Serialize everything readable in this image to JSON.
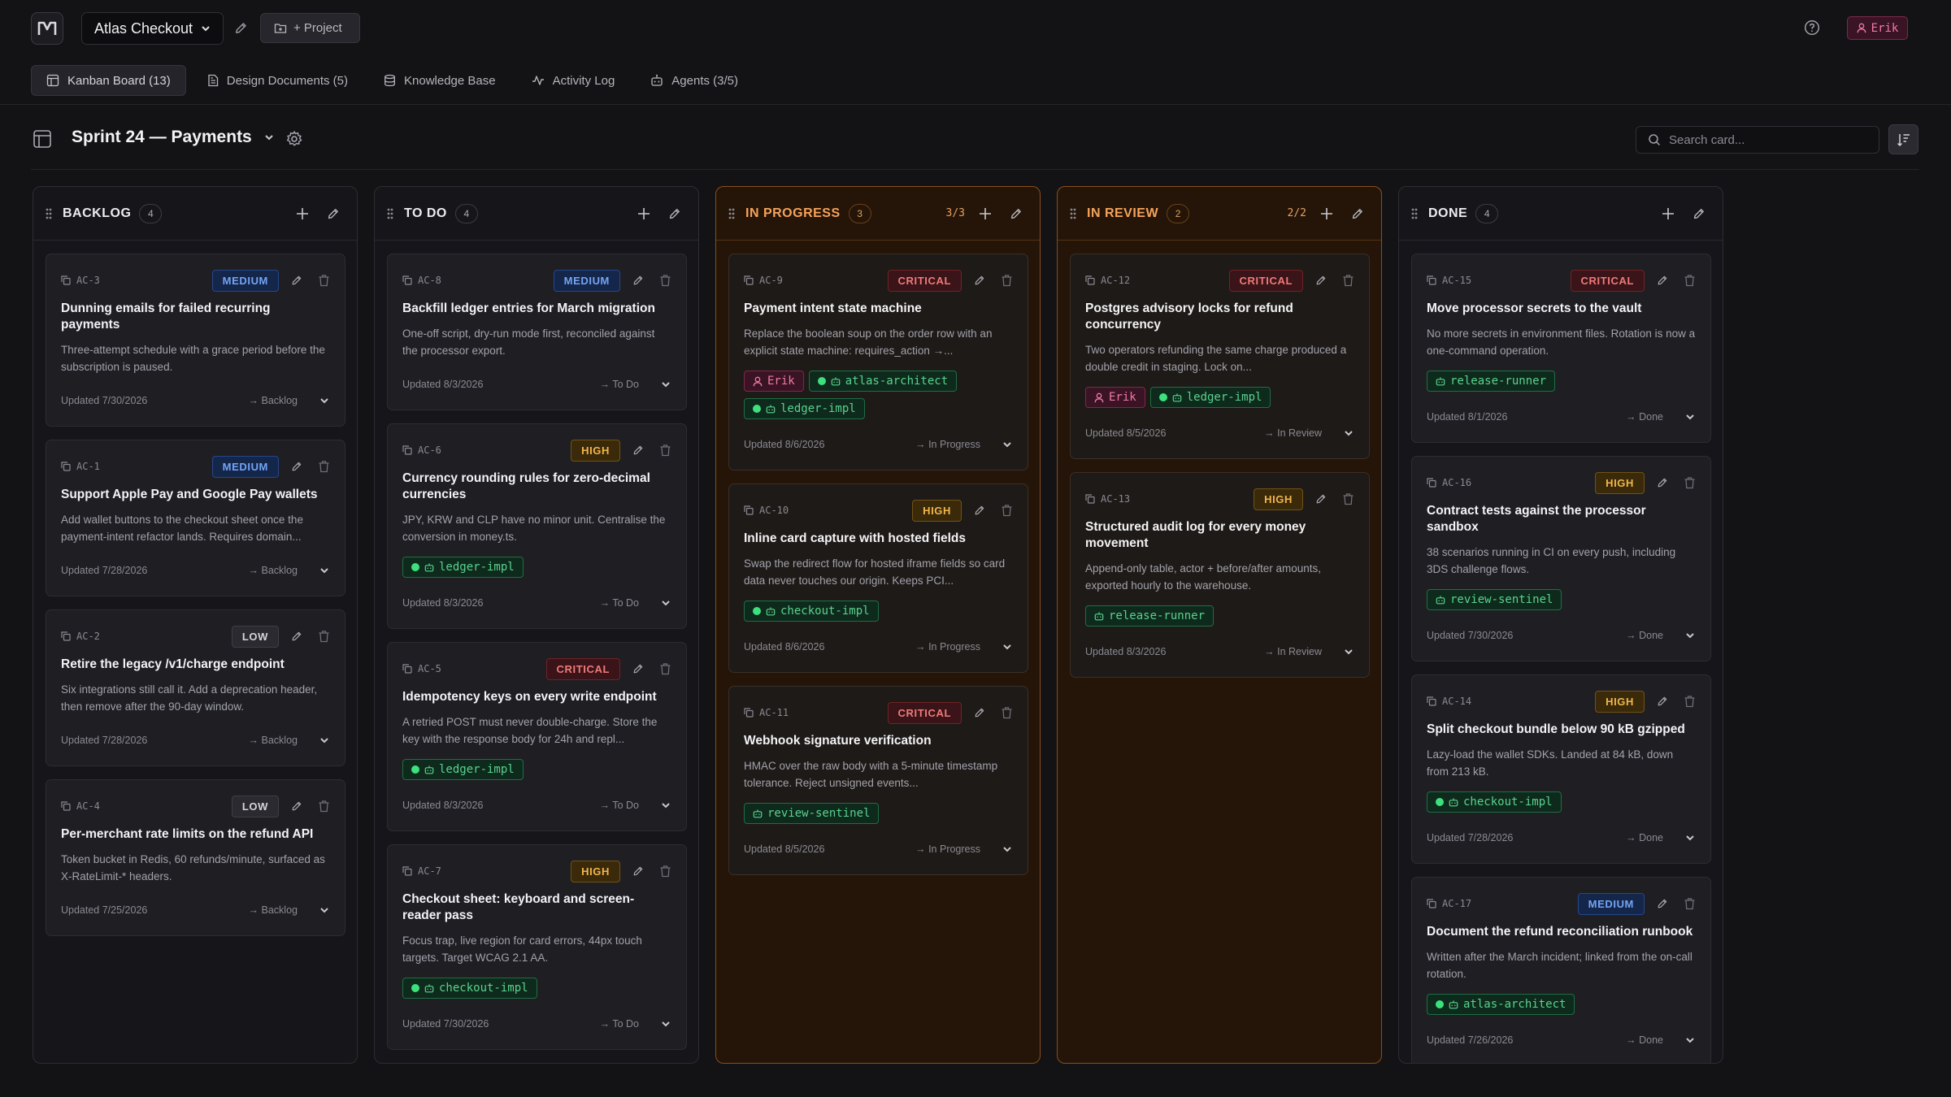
{
  "app": {
    "project_name": "Atlas Checkout",
    "add_project_label": "+ Project",
    "user": "Erik"
  },
  "tabs": [
    {
      "label": "Kanban Board (13)",
      "icon": "board-icon",
      "active": true
    },
    {
      "label": "Design Documents (5)",
      "icon": "document-icon",
      "active": false
    },
    {
      "label": "Knowledge Base",
      "icon": "database-icon",
      "active": false
    },
    {
      "label": "Activity Log",
      "icon": "activity-icon",
      "active": false
    },
    {
      "label": "Agents (3/5)",
      "icon": "robot-icon",
      "active": false
    }
  ],
  "board": {
    "title": "Sprint 24 — Payments",
    "search_placeholder": "Search card..."
  },
  "columns": [
    {
      "title": "BACKLOG",
      "count": "4",
      "wip": "",
      "highlight": false,
      "cards": [
        {
          "id": "AC-3",
          "priority": "MEDIUM",
          "title": "Dunning emails for failed recurring payments",
          "description": "Three-attempt schedule with a grace period before the subscription is paused.",
          "chips": [],
          "updated": "Updated 7/30/2026",
          "move": "→ Backlog"
        },
        {
          "id": "AC-1",
          "priority": "MEDIUM",
          "title": "Support Apple Pay and Google Pay wallets",
          "description": "Add wallet buttons to the checkout sheet once the payment-intent refactor lands. Requires domain...",
          "chips": [],
          "updated": "Updated 7/28/2026",
          "move": "→ Backlog"
        },
        {
          "id": "AC-2",
          "priority": "LOW",
          "title": "Retire the legacy /v1/charge endpoint",
          "description": "Six integrations still call it. Add a deprecation header, then remove after the 90-day window.",
          "chips": [],
          "updated": "Updated 7/28/2026",
          "move": "→ Backlog"
        },
        {
          "id": "AC-4",
          "priority": "LOW",
          "title": "Per-merchant rate limits on the refund API",
          "description": "Token bucket in Redis, 60 refunds/minute, surfaced as X-RateLimit-* headers.",
          "chips": [],
          "updated": "Updated 7/25/2026",
          "move": "→ Backlog"
        }
      ]
    },
    {
      "title": "TO DO",
      "count": "4",
      "wip": "",
      "highlight": false,
      "cards": [
        {
          "id": "AC-8",
          "priority": "MEDIUM",
          "title": "Backfill ledger entries for March migration",
          "description": "One-off script, dry-run mode first, reconciled against the processor export.",
          "chips": [],
          "updated": "Updated 8/3/2026",
          "move": "→ To Do"
        },
        {
          "id": "AC-6",
          "priority": "HIGH",
          "title": "Currency rounding rules for zero-decimal currencies",
          "description": "JPY, KRW and CLP have no minor unit. Centralise the conversion in money.ts.",
          "chips": [
            {
              "type": "agent",
              "label": "ledger-impl",
              "active": true
            }
          ],
          "updated": "Updated 8/3/2026",
          "move": "→ To Do"
        },
        {
          "id": "AC-5",
          "priority": "CRITICAL",
          "title": "Idempotency keys on every write endpoint",
          "description": "A retried POST must never double-charge. Store the key with the response body for 24h and repl...",
          "chips": [
            {
              "type": "agent",
              "label": "ledger-impl",
              "active": true
            }
          ],
          "updated": "Updated 8/3/2026",
          "move": "→ To Do"
        },
        {
          "id": "AC-7",
          "priority": "HIGH",
          "title": "Checkout sheet: keyboard and screen-reader pass",
          "description": "Focus trap, live region for card errors, 44px touch targets. Target WCAG 2.1 AA.",
          "chips": [
            {
              "type": "agent",
              "label": "checkout-impl",
              "active": true
            }
          ],
          "updated": "Updated 7/30/2026",
          "move": "→ To Do"
        }
      ]
    },
    {
      "title": "IN PROGRESS",
      "count": "3",
      "wip": "3/3",
      "highlight": true,
      "cards": [
        {
          "id": "AC-9",
          "priority": "CRITICAL",
          "title": "Payment intent state machine",
          "description": "Replace the boolean soup on the order row with an explicit state machine: requires_action →...",
          "chips": [
            {
              "type": "user",
              "label": "Erik"
            },
            {
              "type": "agent",
              "label": "atlas-architect",
              "active": true
            },
            {
              "type": "agent",
              "label": "ledger-impl",
              "active": true
            }
          ],
          "updated": "Updated 8/6/2026",
          "move": "→ In Progress"
        },
        {
          "id": "AC-10",
          "priority": "HIGH",
          "title": "Inline card capture with hosted fields",
          "description": "Swap the redirect flow for hosted iframe fields so card data never touches our origin. Keeps PCI...",
          "chips": [
            {
              "type": "agent",
              "label": "checkout-impl",
              "active": true
            }
          ],
          "updated": "Updated 8/6/2026",
          "move": "→ In Progress"
        },
        {
          "id": "AC-11",
          "priority": "CRITICAL",
          "title": "Webhook signature verification",
          "description": "HMAC over the raw body with a 5-minute timestamp tolerance. Reject unsigned events...",
          "chips": [
            {
              "type": "agent",
              "label": "review-sentinel",
              "active": false
            }
          ],
          "updated": "Updated 8/5/2026",
          "move": "→ In Progress"
        }
      ]
    },
    {
      "title": "IN REVIEW",
      "count": "2",
      "wip": "2/2",
      "highlight": true,
      "cards": [
        {
          "id": "AC-12",
          "priority": "CRITICAL",
          "title": "Postgres advisory locks for refund concurrency",
          "description": "Two operators refunding the same charge produced a double credit in staging. Lock on...",
          "chips": [
            {
              "type": "user",
              "label": "Erik"
            },
            {
              "type": "agent",
              "label": "ledger-impl",
              "active": true
            }
          ],
          "updated": "Updated 8/5/2026",
          "move": "→ In Review"
        },
        {
          "id": "AC-13",
          "priority": "HIGH",
          "title": "Structured audit log for every money movement",
          "description": "Append-only table, actor + before/after amounts, exported hourly to the warehouse.",
          "chips": [
            {
              "type": "agent",
              "label": "release-runner",
              "active": false
            }
          ],
          "updated": "Updated 8/3/2026",
          "move": "→ In Review"
        }
      ]
    },
    {
      "title": "DONE",
      "count": "4",
      "wip": "",
      "highlight": false,
      "cards": [
        {
          "id": "AC-15",
          "priority": "CRITICAL",
          "title": "Move processor secrets to the vault",
          "description": "No more secrets in environment files. Rotation is now a one-command operation.",
          "chips": [
            {
              "type": "agent",
              "label": "release-runner",
              "active": false
            }
          ],
          "updated": "Updated 8/1/2026",
          "move": "→ Done"
        },
        {
          "id": "AC-16",
          "priority": "HIGH",
          "title": "Contract tests against the processor sandbox",
          "description": "38 scenarios running in CI on every push, including 3DS challenge flows.",
          "chips": [
            {
              "type": "agent",
              "label": "review-sentinel",
              "active": false
            }
          ],
          "updated": "Updated 7/30/2026",
          "move": "→ Done"
        },
        {
          "id": "AC-14",
          "priority": "HIGH",
          "title": "Split checkout bundle below 90 kB gzipped",
          "description": "Lazy-load the wallet SDKs. Landed at 84 kB, down from 213 kB.",
          "chips": [
            {
              "type": "agent",
              "label": "checkout-impl",
              "active": true
            }
          ],
          "updated": "Updated 7/28/2026",
          "move": "→ Done"
        },
        {
          "id": "AC-17",
          "priority": "MEDIUM",
          "title": "Document the refund reconciliation runbook",
          "description": "Written after the March incident; linked from the on-call rotation.",
          "chips": [
            {
              "type": "agent",
              "label": "atlas-architect",
              "active": true
            }
          ],
          "updated": "Updated 7/26/2026",
          "move": "→ Done"
        }
      ]
    }
  ]
}
